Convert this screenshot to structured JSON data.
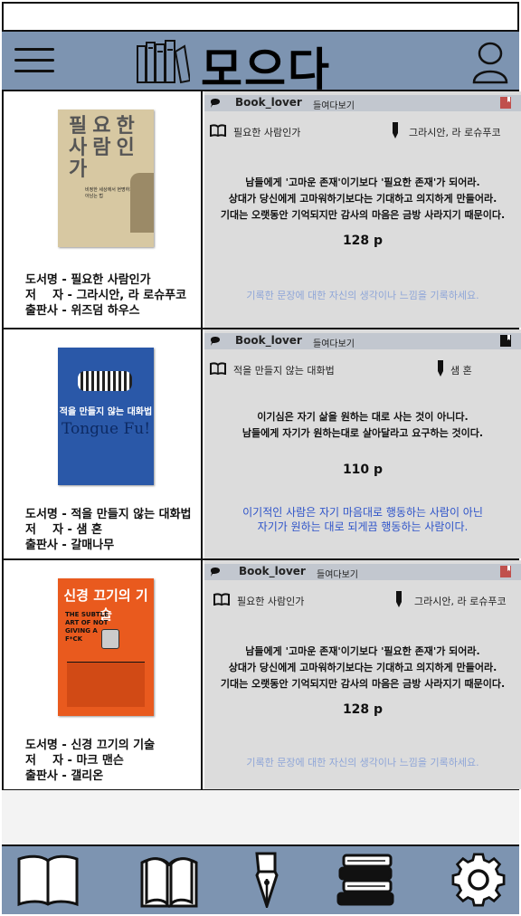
{
  "app": {
    "title": "모으다"
  },
  "icons": {
    "menu": "hamburger-menu-icon",
    "logo": "books-icon",
    "profile": "user-icon",
    "nav": [
      "open-book-icon",
      "reading-book-icon",
      "fountain-pen-icon",
      "book-stack-icon",
      "gear-icon"
    ]
  },
  "colors": {
    "bar": "#7d94b1",
    "panel": "#dcdcdc",
    "note_placeholder": "#8fa6d8",
    "note_text": "#2d53c9",
    "bookmark": "#c0504d"
  },
  "feed": [
    {
      "meta": {
        "title": "도서명 - 필요한 사람인가",
        "author": "저    자 - 그라시안, 라 로슈푸코",
        "publisher": "출판사 - 위즈덤 하우스"
      },
      "cover_text": {
        "title_lines": [
          "필요한",
          "사람인",
          "가"
        ],
        "subtitle": "비정한 세상에서 현명하게 살아남는 법"
      },
      "card": {
        "user": "Book_lover",
        "peek": "들여다보기",
        "book_title": "필요한 사람인가",
        "author": "그라시안, 라 로슈푸코",
        "quote": [
          "남들에게 '고마운 존재'이기보다 '필요한 존재'가 되어라.",
          "상대가 당신에게 고마워하기보다는 기대하고 의지하게 만들어라.",
          "기대는 오랫동안 기억되지만 감사의 마음은 금방 사라지기 때문이다."
        ],
        "page": "128 p",
        "note": [
          "기록한 문장에 대한 자신의 생각이나 느낌을 기록하세요."
        ],
        "bookmarked": true
      }
    },
    {
      "meta": {
        "title": "도서명 - 적을 만들지 않는 대화법",
        "author": "저    자 - 샘 혼",
        "publisher": "출판사 - 갈매나무"
      },
      "cover_text": {
        "title_lines": [
          "적을 만들지 않는 대화법",
          "Tongue Fu!"
        ],
        "subtitle": ""
      },
      "card": {
        "user": "Book_lover",
        "peek": "들여다보기",
        "book_title": "적을 만들지 않는 대화법",
        "author": "샘 혼",
        "quote": [
          "이기심은 자기 삶을 원하는 대로 사는 것이 아니다.",
          "남들에게 자기가 원하는대로 살아달라고 요구하는 것이다."
        ],
        "page": "110 p",
        "note": [
          "이기적인 사람은 자기 마음대로 행동하는 사람이 아닌",
          "자기가 원하는 대로 되게끔 행동하는 사람이다."
        ],
        "bookmarked": false
      }
    },
    {
      "meta": {
        "title": "도서명 - 신경 끄기의 기술",
        "author": "저    자 - 마크 맨슨",
        "publisher": "출판사 - 갤리온"
      },
      "cover_text": {
        "title_lines": [
          "신경 끄기의 기술"
        ],
        "subtitle": "THE SUBTLE ART OF NOT GIVING A F*CK"
      },
      "card": {
        "user": "Book_lover",
        "peek": "들여다보기",
        "book_title": "필요한 사람인가",
        "author": "그라시안, 라 로슈푸코",
        "quote": [
          "남들에게 '고마운 존재'이기보다 '필요한 존재'가 되어라.",
          "상대가 당신에게 고마워하기보다는 기대하고 의지하게 만들어라.",
          "기대는 오랫동안 기억되지만 감사의 마음은 금방 사라지기 때문이다."
        ],
        "page": "128 p",
        "note": [
          "기록한 문장에 대한 자신의 생각이나 느낌을 기록하세요."
        ],
        "bookmarked": true
      }
    }
  ]
}
